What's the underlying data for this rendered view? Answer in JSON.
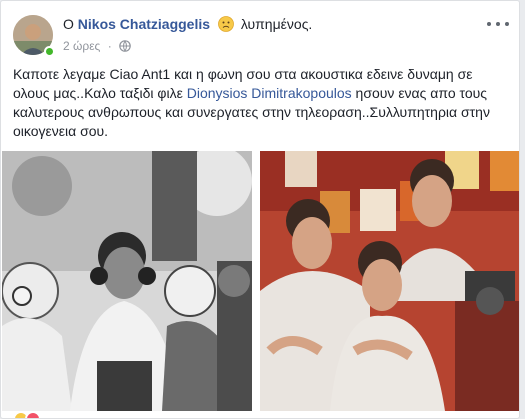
{
  "post": {
    "prefix": "Ο",
    "author": "Nikos Chatziaggelis",
    "feeling": "λυπημένος.",
    "time": "2 ώρες",
    "dot": "·",
    "privacy_icon": "globe-icon",
    "more_icon": "more-horizontal-icon",
    "body": {
      "part1": "Καποτε λεγαμε Ciao Ant1 και η φωνη σου στα ακουστικα εδεινε δυναμη σε ολους μας..Καλο ταξιδι φιλε ",
      "tag": "Dionysios Dimitrakopoulos",
      "part2": " ησουν ενας απο τους καλυτερους ανθρωπους και συνεργατες στην τηλεοραση..Συλλυπητηρια στην οικογενεια σου."
    }
  },
  "colors": {
    "link": "#365899",
    "text": "#1d2129",
    "meta": "#90949c",
    "online": "#42b72a"
  }
}
